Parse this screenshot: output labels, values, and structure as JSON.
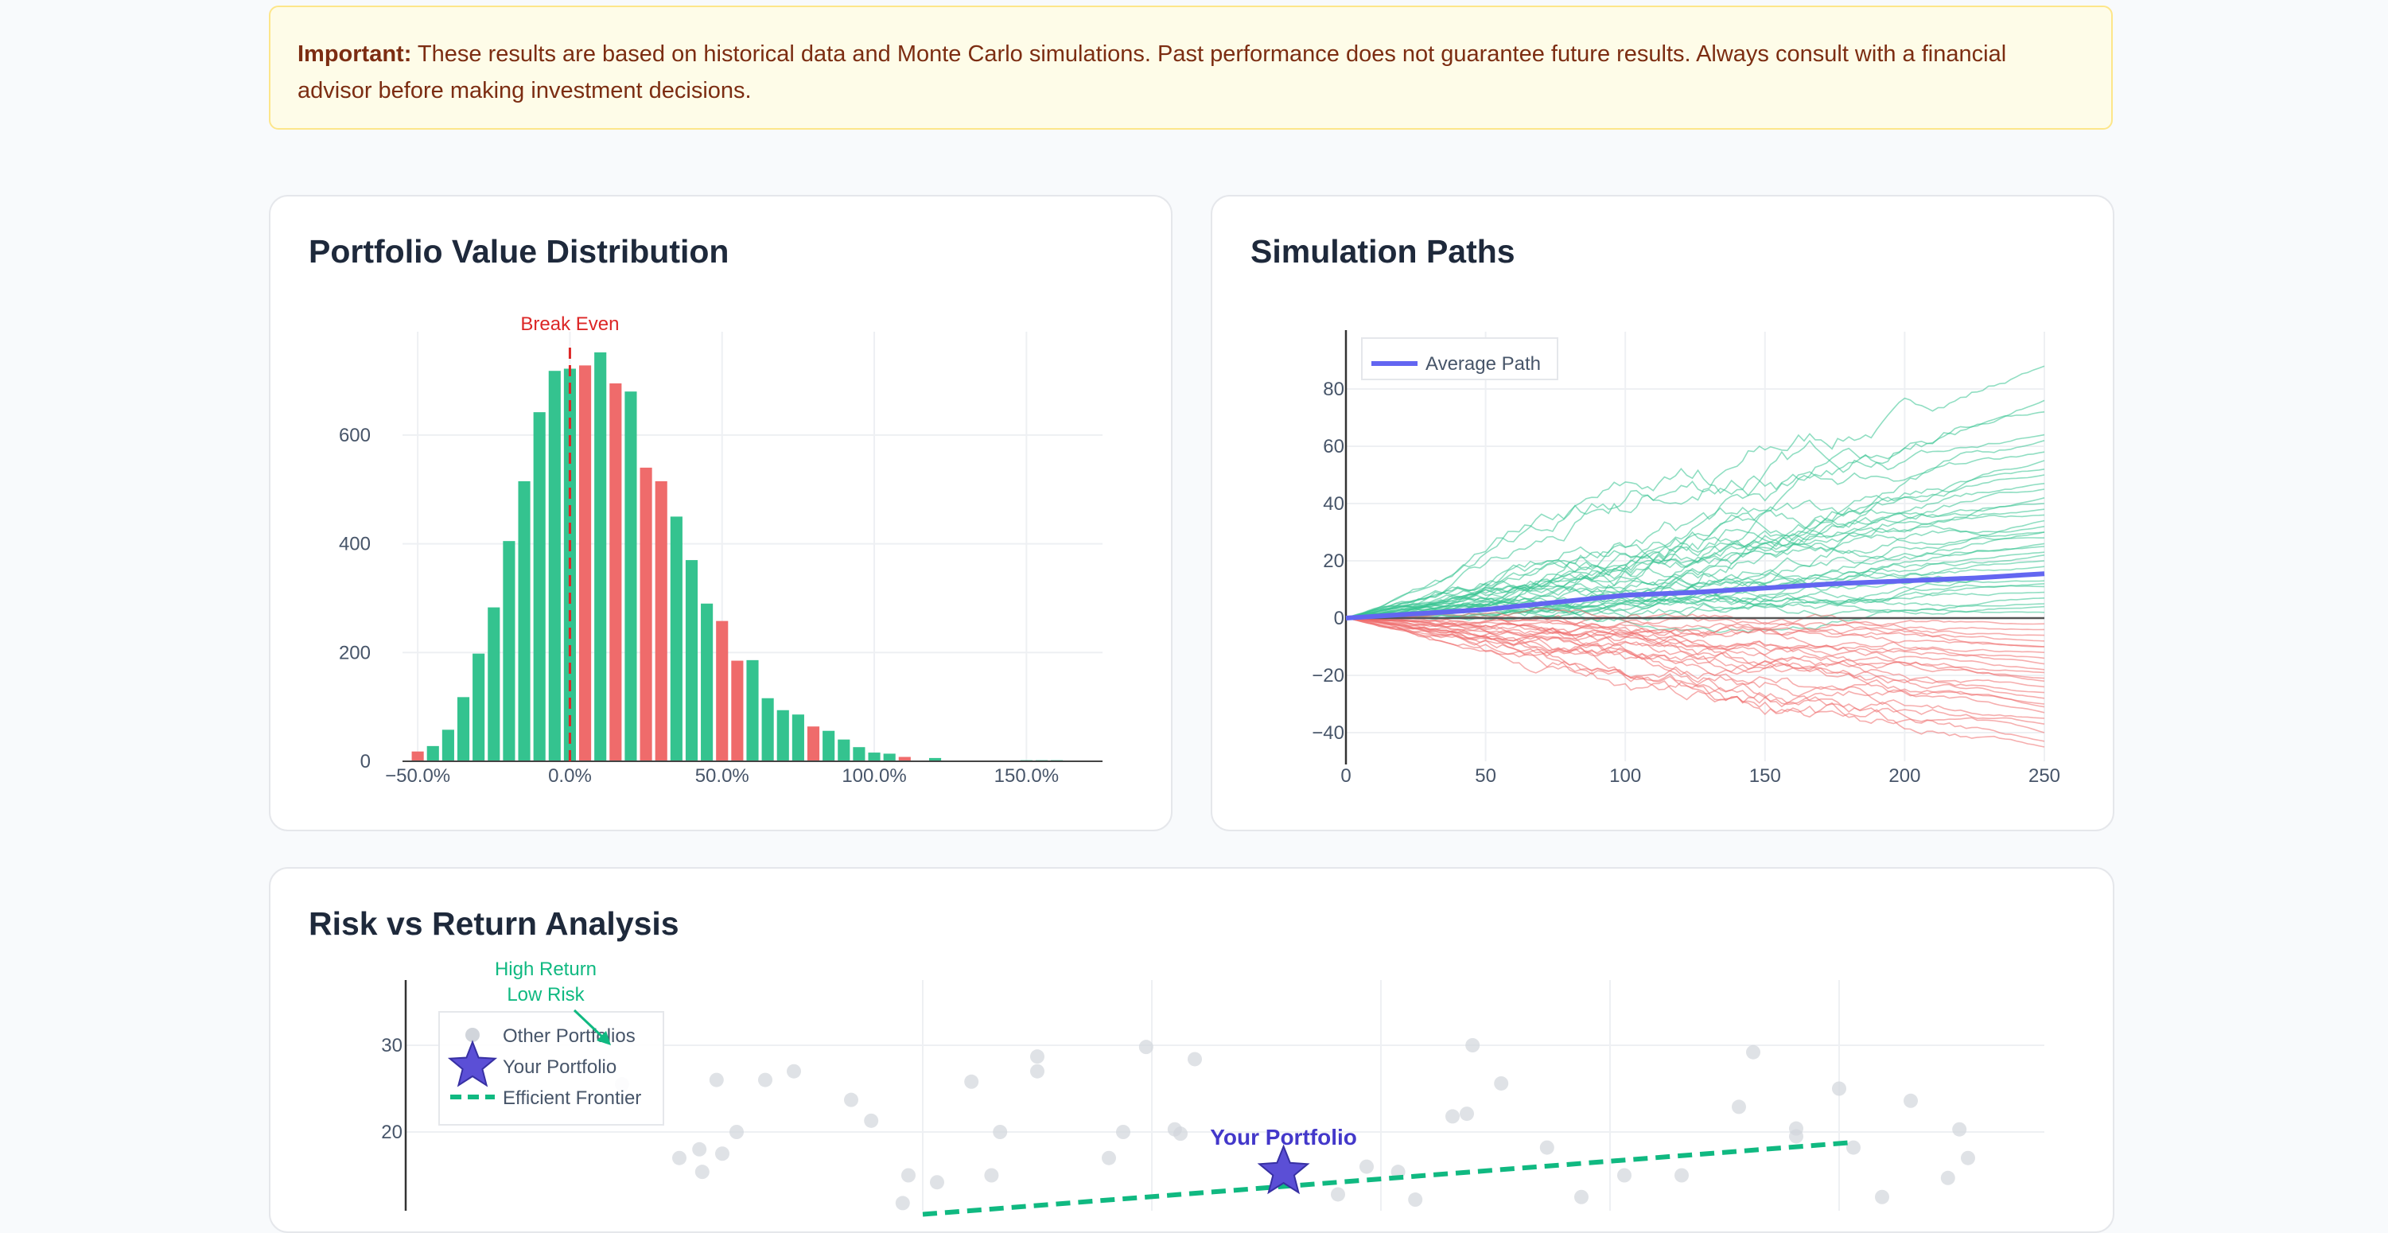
{
  "notice": {
    "label": "Important:",
    "text": " These results are based on historical data and Monte Carlo simulations. Past performance does not guarantee future results. Always consult with a financial advisor before making investment decisions."
  },
  "colors": {
    "gain": "#34c38f",
    "loss": "#ef6b6b",
    "average": "#6366f1",
    "frontier": "#10b981",
    "break_even": "#dc2626",
    "other_portfolios": "#d1d5db"
  },
  "chart_data": [
    {
      "type": "bar",
      "title": "Portfolio Value Distribution",
      "xlabel": "",
      "ylabel": "",
      "x_tick_labels": [
        "−50.0%",
        "0.0%",
        "50.0%",
        "100.0%",
        "150.0%"
      ],
      "x_tick_values": [
        -50,
        0,
        50,
        100,
        150
      ],
      "y_tick_values": [
        0,
        200,
        400,
        600
      ],
      "xlim": [
        -55,
        175
      ],
      "ylim": [
        0,
        790
      ],
      "bin_width": 5,
      "bins": [
        {
          "x": -50,
          "y": 18,
          "c": "loss"
        },
        {
          "x": -45,
          "y": 28,
          "c": "gain"
        },
        {
          "x": -40,
          "y": 58,
          "c": "gain"
        },
        {
          "x": -35,
          "y": 118,
          "c": "gain"
        },
        {
          "x": -30,
          "y": 198,
          "c": "gain"
        },
        {
          "x": -25,
          "y": 283,
          "c": "gain"
        },
        {
          "x": -20,
          "y": 405,
          "c": "gain"
        },
        {
          "x": -15,
          "y": 515,
          "c": "gain"
        },
        {
          "x": -10,
          "y": 642,
          "c": "gain"
        },
        {
          "x": -5,
          "y": 718,
          "c": "gain"
        },
        {
          "x": 0,
          "y": 722,
          "c": "gain"
        },
        {
          "x": 5,
          "y": 728,
          "c": "loss"
        },
        {
          "x": 10,
          "y": 752,
          "c": "gain"
        },
        {
          "x": 15,
          "y": 695,
          "c": "loss"
        },
        {
          "x": 20,
          "y": 680,
          "c": "gain"
        },
        {
          "x": 25,
          "y": 540,
          "c": "loss"
        },
        {
          "x": 30,
          "y": 515,
          "c": "loss"
        },
        {
          "x": 35,
          "y": 450,
          "c": "gain"
        },
        {
          "x": 40,
          "y": 370,
          "c": "gain"
        },
        {
          "x": 45,
          "y": 290,
          "c": "gain"
        },
        {
          "x": 50,
          "y": 258,
          "c": "loss"
        },
        {
          "x": 55,
          "y": 185,
          "c": "loss"
        },
        {
          "x": 60,
          "y": 186,
          "c": "gain"
        },
        {
          "x": 65,
          "y": 116,
          "c": "gain"
        },
        {
          "x": 70,
          "y": 94,
          "c": "gain"
        },
        {
          "x": 75,
          "y": 86,
          "c": "gain"
        },
        {
          "x": 80,
          "y": 64,
          "c": "loss"
        },
        {
          "x": 85,
          "y": 56,
          "c": "gain"
        },
        {
          "x": 90,
          "y": 40,
          "c": "gain"
        },
        {
          "x": 95,
          "y": 26,
          "c": "gain"
        },
        {
          "x": 100,
          "y": 16,
          "c": "gain"
        },
        {
          "x": 105,
          "y": 14,
          "c": "gain"
        },
        {
          "x": 110,
          "y": 8,
          "c": "loss"
        },
        {
          "x": 120,
          "y": 6,
          "c": "gain"
        },
        {
          "x": 150,
          "y": 2,
          "c": "gain"
        },
        {
          "x": 155,
          "y": 2,
          "c": "gain"
        },
        {
          "x": 160,
          "y": 2,
          "c": "gain"
        }
      ],
      "annotations": [
        {
          "text": "Break Even",
          "x": 0
        }
      ],
      "grid": true
    },
    {
      "type": "line",
      "title": "Simulation Paths",
      "x_tick_values": [
        0,
        50,
        100,
        150,
        200,
        250
      ],
      "y_tick_values": [
        -40,
        -20,
        0,
        20,
        40,
        60,
        80
      ],
      "xlim": [
        0,
        250
      ],
      "ylim": [
        -50,
        100
      ],
      "legend": {
        "position": "top-left",
        "entries": [
          "Average Path"
        ]
      },
      "average_path": {
        "name": "Average Path",
        "x": [
          0,
          25,
          50,
          75,
          100,
          125,
          150,
          175,
          200,
          225,
          250
        ],
        "y": [
          0,
          1.5,
          3,
          5.5,
          8,
          9,
          10.5,
          12,
          13,
          14,
          15.5
        ]
      },
      "simulated_paths": {
        "count": 60,
        "gain_color": "gain",
        "loss_color": "loss",
        "final_values": [
          88,
          76,
          72,
          64,
          62,
          58,
          55,
          52,
          50,
          47,
          45,
          42,
          40,
          38,
          36,
          34,
          32,
          30,
          28,
          26,
          25,
          23,
          22,
          20,
          18,
          16,
          15,
          13,
          11,
          9,
          7,
          5,
          4,
          2,
          -2,
          -4,
          -6,
          -8,
          -10,
          -12,
          -14,
          -16,
          -18,
          -19,
          -21,
          -22,
          -24,
          -26,
          -28,
          -30,
          -31,
          -33,
          -35,
          -37,
          -40,
          -43,
          -45,
          -10,
          12,
          30
        ]
      },
      "grid": true
    },
    {
      "type": "scatter",
      "title": "Risk vs Return Analysis",
      "y_tick_values": [
        20,
        30
      ],
      "xlim": [
        0,
        40
      ],
      "ylim": [
        10,
        33
      ],
      "legend": {
        "position": "top-left",
        "entries": [
          "Other Portfolios",
          "Your Portfolio",
          "Efficient Frontier"
        ]
      },
      "annotations": [
        {
          "text": "High Return\nLow Risk"
        },
        {
          "text": "Your Portfolio"
        }
      ],
      "other_portfolios": [
        [
          5.5,
          25.5
        ],
        [
          7.5,
          17
        ],
        [
          8.2,
          18
        ],
        [
          8.3,
          15.4
        ],
        [
          8.8,
          26
        ],
        [
          9,
          17.5
        ],
        [
          9.5,
          20
        ],
        [
          10.5,
          26
        ],
        [
          11.5,
          27
        ],
        [
          13.5,
          23.7
        ],
        [
          14.2,
          21.3
        ],
        [
          15.3,
          11.8
        ],
        [
          15.5,
          15
        ],
        [
          16.5,
          14.2
        ],
        [
          17.7,
          25.8
        ],
        [
          18.4,
          15
        ],
        [
          18.7,
          20
        ],
        [
          20,
          28.7
        ],
        [
          20,
          27
        ],
        [
          22.5,
          17
        ],
        [
          23,
          20
        ],
        [
          23.8,
          29.8
        ],
        [
          24.8,
          20.3
        ],
        [
          25,
          19.8
        ],
        [
          25.5,
          28.4
        ],
        [
          28.8,
          15.4
        ],
        [
          30.5,
          12.8
        ],
        [
          31.5,
          16
        ],
        [
          32.6,
          15.4
        ],
        [
          33.2,
          12.2
        ],
        [
          34.5,
          21.8
        ],
        [
          35,
          22.1
        ],
        [
          35.2,
          30
        ],
        [
          36.2,
          25.6
        ],
        [
          37.8,
          18.2
        ],
        [
          39,
          12.5
        ],
        [
          40.5,
          15
        ],
        [
          42.5,
          15
        ],
        [
          44.5,
          22.9
        ],
        [
          45,
          29.2
        ],
        [
          46.5,
          20.4
        ],
        [
          46.5,
          19.5
        ],
        [
          48,
          25
        ],
        [
          48.5,
          18.2
        ],
        [
          49.5,
          12.5
        ],
        [
          50.5,
          23.6
        ],
        [
          51.8,
          14.7
        ],
        [
          52.2,
          20.3
        ],
        [
          52.5,
          17
        ]
      ],
      "your_portfolio": [
        28.6,
        15.4
      ],
      "efficient_frontier": {
        "x": [
          16,
          48.5
        ],
        "y": [
          10.5,
          18.8
        ]
      },
      "grid": true
    }
  ]
}
